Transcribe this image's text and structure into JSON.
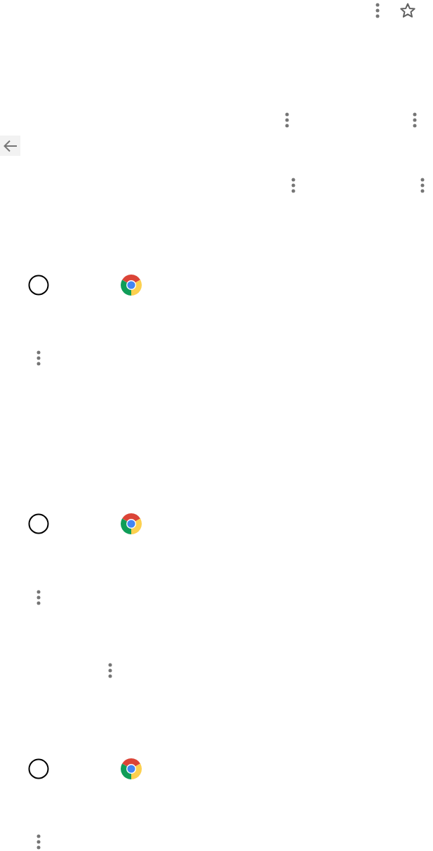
{
  "blocks": [
    {
      "kind": "toolbar"
    },
    {
      "kind": "menu-pair"
    },
    {
      "kind": "back-button"
    },
    {
      "kind": "menu-pair"
    },
    {
      "kind": "tab-row"
    },
    {
      "kind": "menu-single"
    },
    {
      "kind": "tab-row"
    },
    {
      "kind": "menu-single"
    },
    {
      "kind": "menu-single"
    },
    {
      "kind": "tab-row"
    },
    {
      "kind": "menu-single"
    }
  ]
}
